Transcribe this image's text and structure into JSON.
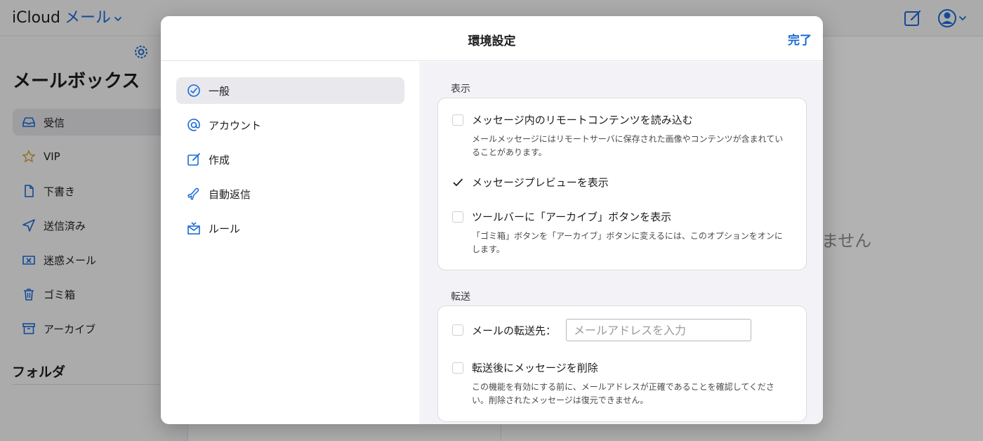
{
  "app": {
    "brand": "iCloud",
    "mail_menu": "メール"
  },
  "sidebar": {
    "heading": "メールボックス",
    "items": [
      {
        "label": "受信",
        "icon": "inbox-icon"
      },
      {
        "label": "VIP",
        "icon": "star-icon"
      },
      {
        "label": "下書き",
        "icon": "document-icon"
      },
      {
        "label": "送信済み",
        "icon": "paperplane-icon"
      },
      {
        "label": "迷惑メール",
        "icon": "junk-icon"
      },
      {
        "label": "ゴミ箱",
        "icon": "trash-icon"
      },
      {
        "label": "アーカイブ",
        "icon": "archive-icon"
      }
    ],
    "folders_heading": "フォルダ"
  },
  "detail": {
    "text": "ません"
  },
  "modal": {
    "title": "環境設定",
    "done_label": "完了",
    "nav": [
      {
        "label": "一般",
        "icon": "checkmark-circle-icon"
      },
      {
        "label": "アカウント",
        "icon": "at-icon"
      },
      {
        "label": "作成",
        "icon": "compose-icon"
      },
      {
        "label": "自動返信",
        "icon": "airplane-icon"
      },
      {
        "label": "ルール",
        "icon": "rules-envelope-icon"
      }
    ],
    "sections": {
      "display": {
        "label": "表示",
        "options": [
          {
            "label": "メッセージ内のリモートコンテンツを読み込む",
            "checked": false,
            "description": "メールメッセージにはリモートサーバに保存された画像やコンテンツが含まれていることがあります。"
          },
          {
            "label": "メッセージプレビューを表示",
            "checked": true
          },
          {
            "label": "ツールバーに「アーカイブ」ボタンを表示",
            "checked": false,
            "description": "「ゴミ箱」ボタンを「アーカイブ」ボタンに変えるには、このオプションをオンにします。"
          }
        ]
      },
      "forwarding": {
        "label": "転送",
        "forward_label": "メールの転送先：",
        "forward_placeholder": "メールアドレスを入力",
        "forward_value": "",
        "delete_label": "転送後にメッセージを削除",
        "delete_description": "この機能を有効にする前に、メールアドレスが正確であることを確認してください。削除されたメッセージは復元できません。"
      }
    }
  },
  "colors": {
    "accent": "#1a6ad6"
  }
}
